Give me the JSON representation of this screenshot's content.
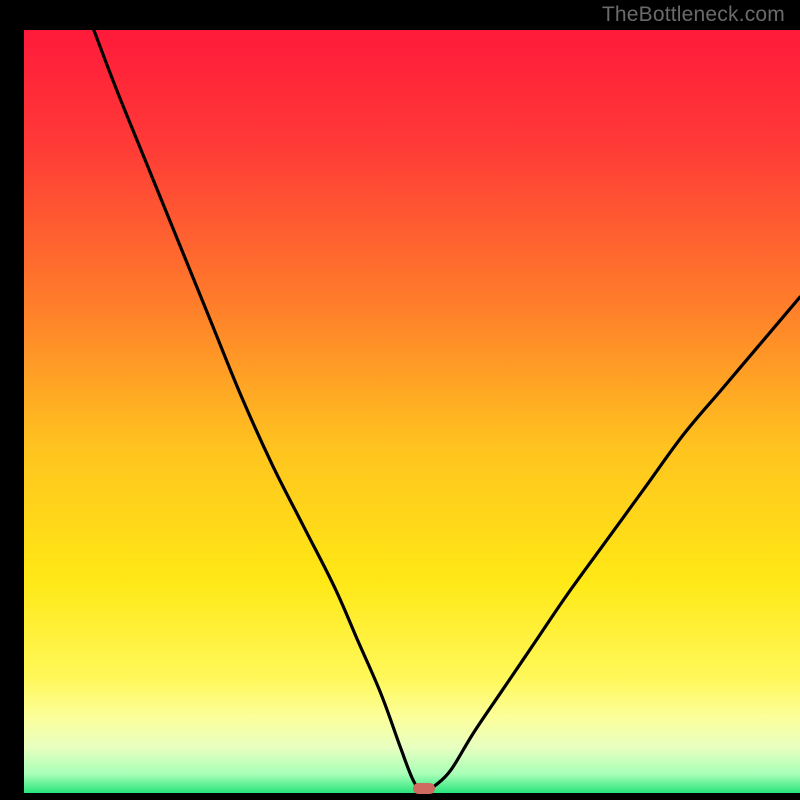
{
  "watermark": {
    "text": "TheBottleneck.com"
  },
  "gradient": {
    "stops": [
      {
        "offset": 0.0,
        "color": "#ff1a3a"
      },
      {
        "offset": 0.15,
        "color": "#ff3a37"
      },
      {
        "offset": 0.35,
        "color": "#ff7a2b"
      },
      {
        "offset": 0.55,
        "color": "#ffc41f"
      },
      {
        "offset": 0.72,
        "color": "#ffe815"
      },
      {
        "offset": 0.85,
        "color": "#fff85a"
      },
      {
        "offset": 0.9,
        "color": "#fcff9a"
      },
      {
        "offset": 0.94,
        "color": "#e8ffc0"
      },
      {
        "offset": 0.975,
        "color": "#a8ffb8"
      },
      {
        "offset": 1.0,
        "color": "#28e47a"
      }
    ]
  },
  "chart_data": {
    "type": "line",
    "title": "",
    "xlabel": "",
    "ylabel": "",
    "xlim": [
      0,
      100
    ],
    "ylim": [
      0,
      100
    ],
    "grid": false,
    "legend": false,
    "annotations": [],
    "marker": {
      "x": 51.5,
      "y": 0.5
    },
    "series": [
      {
        "name": "bottleneck-curve",
        "x": [
          9,
          12,
          16,
          20,
          24,
          28,
          32,
          36,
          40,
          43,
          46,
          48.5,
          50,
          51,
          52,
          53,
          55,
          58,
          62,
          66,
          70,
          75,
          80,
          85,
          90,
          95,
          100
        ],
        "y": [
          100,
          92,
          82,
          72,
          62,
          52,
          43,
          35,
          27,
          20,
          13,
          6,
          2,
          0.5,
          0.5,
          1,
          3,
          8,
          14,
          20,
          26,
          33,
          40,
          47,
          53,
          59,
          65
        ]
      }
    ]
  }
}
